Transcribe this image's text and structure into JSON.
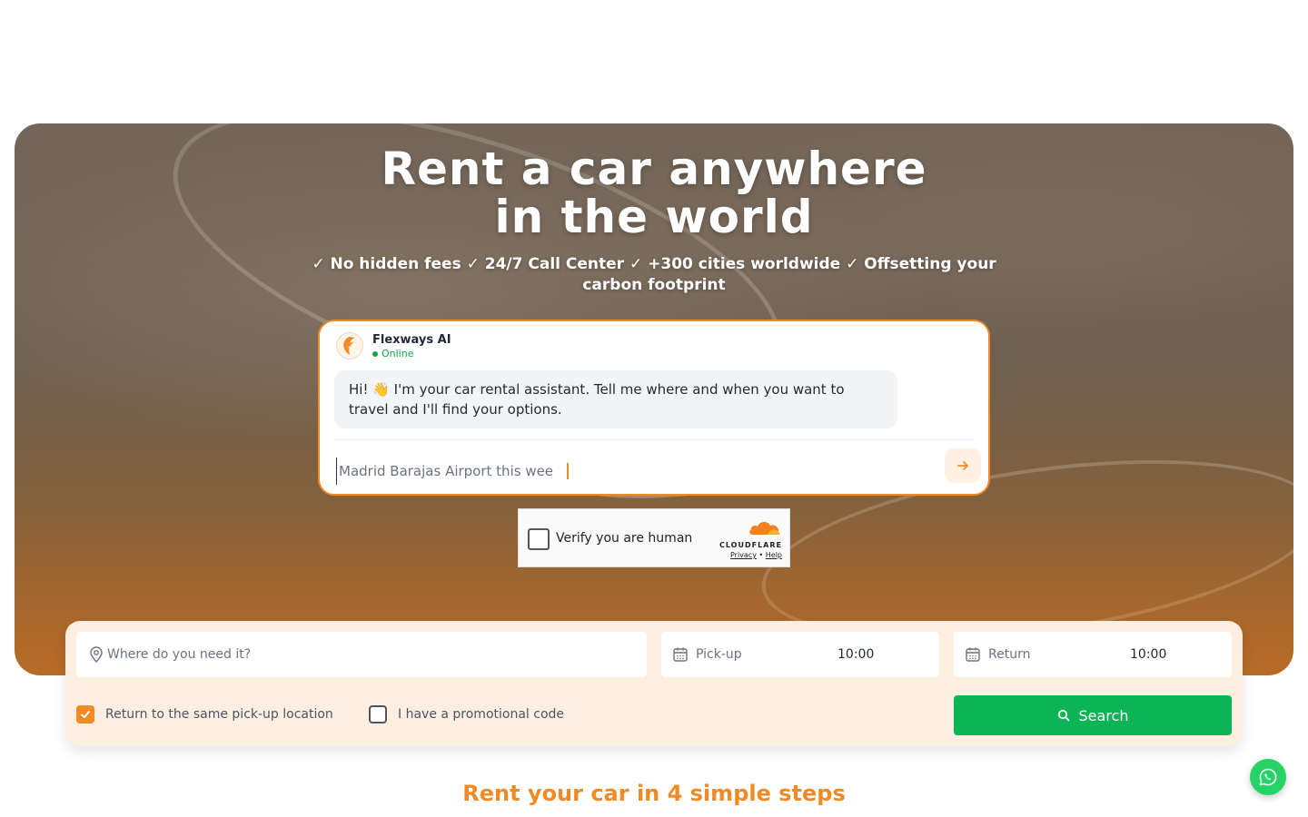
{
  "hero": {
    "title_line1": "Rent a car anywhere",
    "title_line2": "in the world",
    "subtitle": "✓ No hidden fees ✓ 24/7 Call Center ✓ +300 cities worldwide ✓ Offsetting your carbon footprint"
  },
  "chat": {
    "agent_name": "Flexways AI",
    "status": "Online",
    "message": "Hi! 👋 I'm your car rental assistant. Tell me where and when you want to travel and I'll find your options.",
    "input_placeholder": "Madrid Barajas Airport this wee",
    "send_icon": "arrow-right-icon"
  },
  "captcha": {
    "label": "Verify you are human",
    "brand": "CLOUDFLARE",
    "privacy": "Privacy",
    "separator": "•",
    "help": "Help"
  },
  "search": {
    "location_placeholder": "Where do you need it?",
    "pickup_label": "Pick-up",
    "pickup_time": "10:00",
    "return_label": "Return",
    "return_time": "10:00",
    "same_location_label": "Return to the same pick-up location",
    "same_location_checked": true,
    "promo_label": "I have a promotional code",
    "promo_checked": false,
    "button_label": "Search"
  },
  "steps": {
    "title": "Rent your car in 4 simple steps"
  },
  "colors": {
    "accent": "#f08a24",
    "search_button": "#0bb454",
    "whatsapp": "#25d366",
    "panel_bg": "#fdeee2"
  }
}
